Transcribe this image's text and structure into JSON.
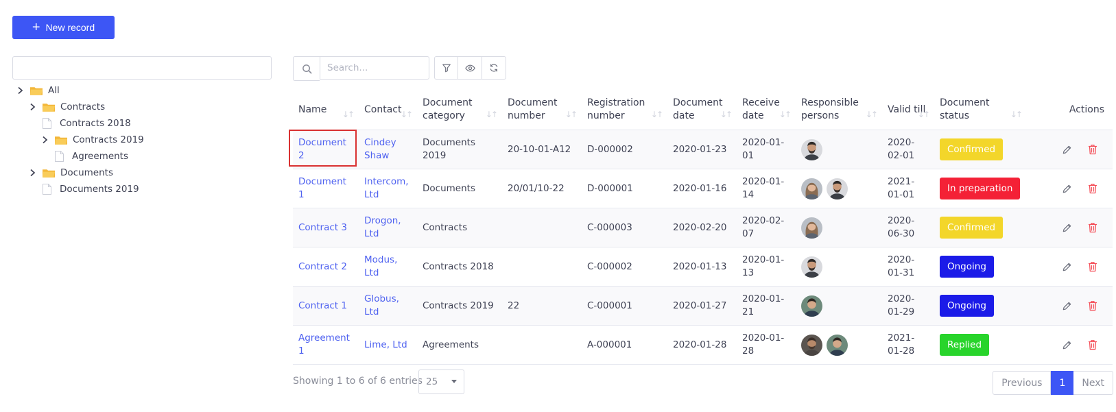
{
  "new_record_button": {
    "label": "New record"
  },
  "tree": {
    "items": [
      {
        "label": "All",
        "type": "folder",
        "expandable": true
      },
      {
        "label": "Contracts",
        "type": "folder",
        "expandable": true
      },
      {
        "label": "Contracts 2018",
        "type": "file",
        "expandable": false
      },
      {
        "label": "Contracts 2019",
        "type": "folder",
        "expandable": true
      },
      {
        "label": "Agreements",
        "type": "file",
        "expandable": false
      },
      {
        "label": "Documents",
        "type": "folder",
        "expandable": true
      },
      {
        "label": "Documents 2019",
        "type": "file",
        "expandable": false
      }
    ]
  },
  "toolbar": {
    "search_placeholder": "Search...",
    "buttons": [
      "filter-icon",
      "eye-icon",
      "refresh-icon"
    ]
  },
  "table": {
    "columns": [
      "Name",
      "Contact",
      "Document category",
      "Document number",
      "Registration number",
      "Document date",
      "Receive date",
      "Responsible persons",
      "Valid till",
      "Document status",
      "Actions"
    ],
    "rows": [
      {
        "name": "Document 2",
        "contact": "Cindey Shaw",
        "category": "Documents 2019",
        "doc_number": "20-10-01-A12",
        "reg_number": "D-000002",
        "doc_date": "2020-01-23",
        "receive_date": "2020-01-01",
        "valid_till": "2020-02-01",
        "status": "Confirmed",
        "status_color": "#f3d62a",
        "avatars": [
          "avatar-man-beard"
        ]
      },
      {
        "name": "Document 1",
        "contact": "Intercom, Ltd",
        "category": "Documents",
        "doc_number": "20/01/10-22",
        "reg_number": "D-000001",
        "doc_date": "2020-01-16",
        "receive_date": "2020-01-14",
        "valid_till": "2021-01-01",
        "status": "In preparation",
        "status_color": "#f42136",
        "avatars": [
          "avatar-woman",
          "avatar-man-beard"
        ]
      },
      {
        "name": "Contract 3",
        "contact": "Drogon, Ltd",
        "category": "Contracts",
        "doc_number": "",
        "reg_number": "C-000003",
        "doc_date": "2020-02-20",
        "receive_date": "2020-02-07",
        "valid_till": "2020-06-30",
        "status": "Confirmed",
        "status_color": "#f3d62a",
        "avatars": [
          "avatar-woman"
        ]
      },
      {
        "name": "Contract 2",
        "contact": "Modus, Ltd",
        "category": "Contracts 2018",
        "doc_number": "",
        "reg_number": "C-000002",
        "doc_date": "2020-01-13",
        "receive_date": "2020-01-13",
        "valid_till": "2020-01-31",
        "status": "Ongoing",
        "status_color": "#1b1be8",
        "avatars": [
          "avatar-man-beard"
        ]
      },
      {
        "name": "Contract 1",
        "contact": "Globus, Ltd",
        "category": "Contracts 2019",
        "doc_number": "22",
        "reg_number": "C-000001",
        "doc_date": "2020-01-27",
        "receive_date": "2020-01-21",
        "valid_till": "2020-01-29",
        "status": "Ongoing",
        "status_color": "#1b1be8",
        "avatars": [
          "avatar-man-outdoor"
        ]
      },
      {
        "name": "Agreement 1",
        "contact": "Lime, Ltd",
        "category": "Agreements",
        "doc_number": "",
        "reg_number": "A-000001",
        "doc_date": "2020-01-28",
        "receive_date": "2020-01-28",
        "valid_till": "2021-01-28",
        "status": "Replied",
        "status_color": "#28d42b",
        "avatars": [
          "avatar-man-dark",
          "avatar-man-outdoor"
        ]
      }
    ]
  },
  "footer": {
    "info": "Showing 1 to 6 of 6 entries",
    "page_size": "25",
    "previous_label": "Previous",
    "current_page": "1",
    "next_label": "Next"
  }
}
